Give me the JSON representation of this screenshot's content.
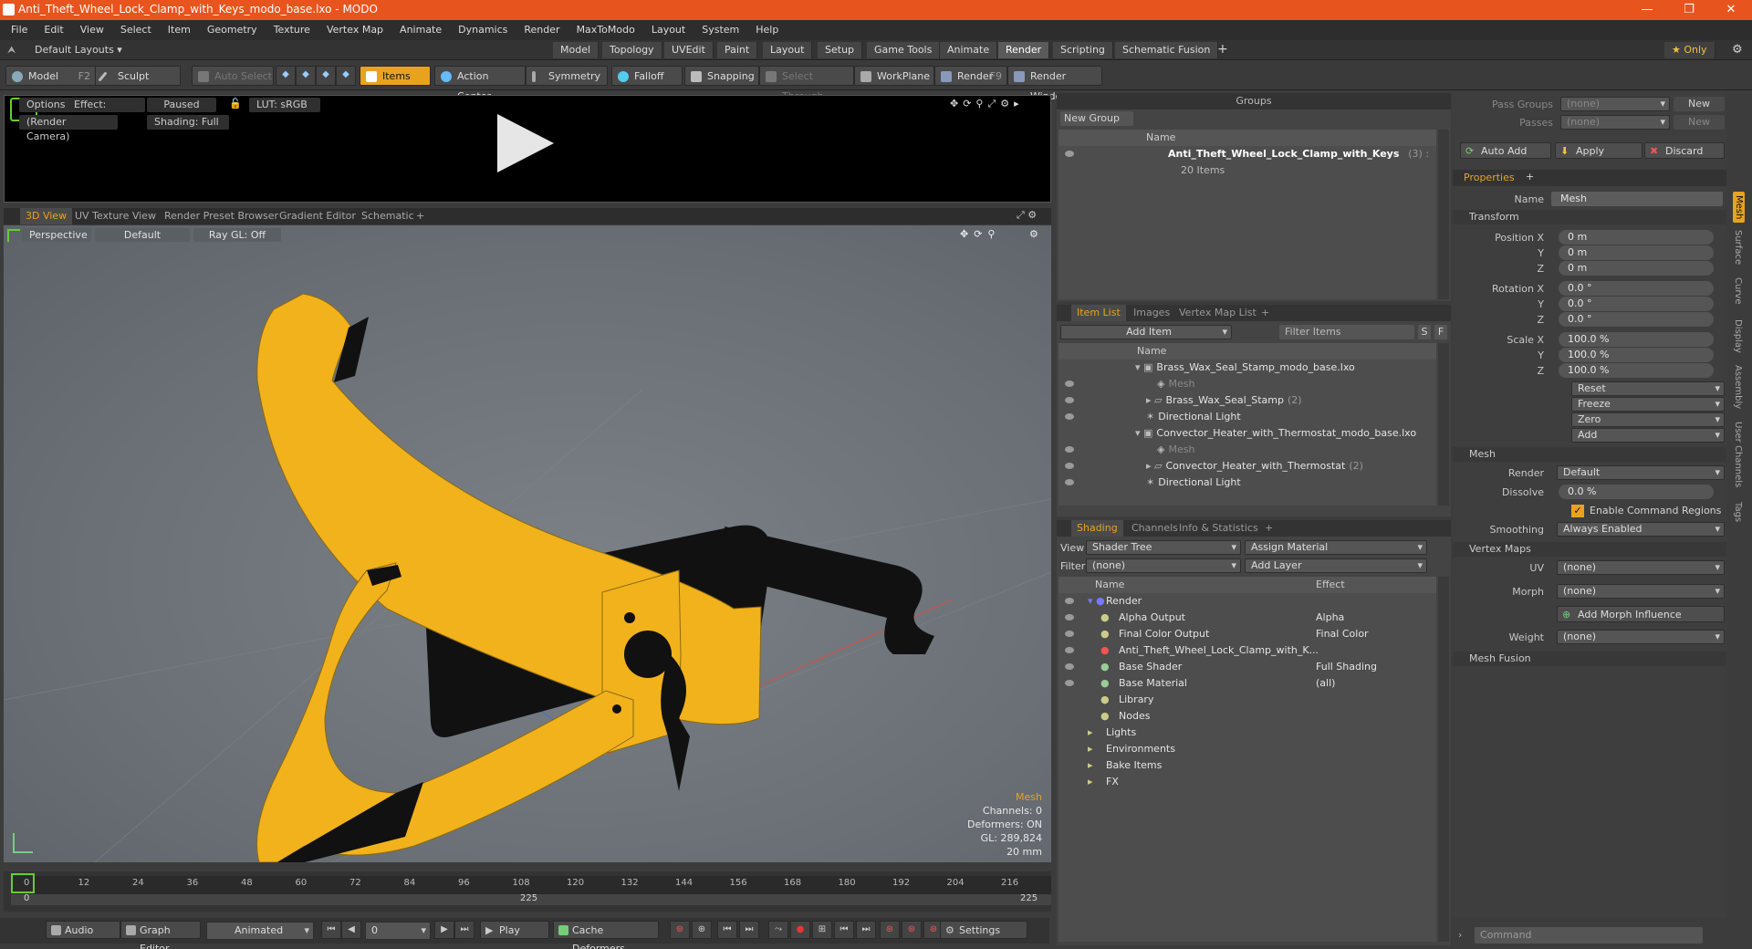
{
  "window": {
    "title": "Anti_Theft_Wheel_Lock_Clamp_with_Keys_modo_base.lxo - MODO",
    "min": "—",
    "max": "❐",
    "close": "✕"
  },
  "menu": [
    "File",
    "Edit",
    "View",
    "Select",
    "Item",
    "Geometry",
    "Texture",
    "Vertex Map",
    "Animate",
    "Dynamics",
    "Render",
    "MaxToModo",
    "Layout",
    "System",
    "Help"
  ],
  "layoutbar": {
    "default_layouts": "Default Layouts ▾",
    "tabs": [
      "Model",
      "Topology",
      "UVEdit",
      "Paint",
      "Layout",
      "Setup",
      "Game Tools",
      "Animate",
      "Render",
      "Scripting",
      "Schematic Fusion"
    ],
    "active_tab": "Render",
    "plus": "+",
    "only": "★  Only"
  },
  "toolbar": {
    "model": "Model",
    "model_key": "F2",
    "sculpt": "Sculpt",
    "auto_select": "Auto Select",
    "items": "Items",
    "action_center": "Action Center",
    "symmetry": "Symmetry",
    "falloff": "Falloff",
    "snapping": "Snapping",
    "select_through": "Select Through",
    "workplane": "WorkPlane",
    "render": "Render",
    "render_key": "F9",
    "render_window": "Render Window"
  },
  "preview": {
    "options": "Options",
    "effect": "Effect: (Shadi...",
    "paused": "Paused",
    "lut": "LUT: sRGB",
    "camera": "(Render Camera)",
    "shading": "Shading: Full"
  },
  "viewport_tabs": [
    "3D View",
    "UV Texture View",
    "Render Preset Browser",
    "Gradient Editor",
    "Schematic",
    "+"
  ],
  "viewport": {
    "perspective": "Perspective",
    "default": "Default",
    "raygl": "Ray GL: Off",
    "info": {
      "type": "Mesh",
      "channels": "Channels: 0",
      "deformers": "Deformers: ON",
      "gl": "GL: 289,824",
      "scale": "20 mm"
    },
    "colors": {
      "body": "#f2b21c",
      "handle": "#111111",
      "edge": "#8a6a10"
    }
  },
  "timeline": {
    "ticks": [
      "0",
      "12",
      "24",
      "36",
      "48",
      "60",
      "72",
      "84",
      "96",
      "108",
      "120",
      "132",
      "144",
      "156",
      "168",
      "180",
      "192",
      "204",
      "216"
    ],
    "start": "0",
    "mid": "225",
    "end": "225"
  },
  "bottombar": {
    "audio": "Audio",
    "graph_editor": "Graph Editor",
    "animated": "Animated",
    "frame": "0",
    "play": "Play",
    "cache_deformers": "Cache Deformers",
    "settings": "Settings"
  },
  "groups": {
    "title": "Groups",
    "new_group": "New Group",
    "col_name": "Name",
    "item": "Anti_Theft_Wheel_Lock_Clamp_with_Keys",
    "item_count": "(3) :",
    "sub": "20 Items"
  },
  "itemlist": {
    "tabs": [
      "Item List",
      "Images",
      "Vertex Map List",
      "+"
    ],
    "add_item": "Add Item",
    "filter": "Filter Items",
    "s": "S",
    "f": "F",
    "col_name": "Name",
    "rows": [
      {
        "label": "Brass_Wax_Seal_Stamp_modo_base.lxo",
        "indent": 0,
        "dim": false
      },
      {
        "label": "Mesh",
        "indent": 2,
        "dim": true
      },
      {
        "label": "Brass_Wax_Seal_Stamp",
        "count": "(2)",
        "indent": 1,
        "dim": false
      },
      {
        "label": "Directional Light",
        "indent": 1,
        "dim": false
      },
      {
        "label": "Convector_Heater_with_Thermostat_modo_base.lxo",
        "indent": 0,
        "dim": false
      },
      {
        "label": "Mesh",
        "indent": 2,
        "dim": true
      },
      {
        "label": "Convector_Heater_with_Thermostat",
        "count": "(2)",
        "indent": 1,
        "dim": false
      },
      {
        "label": "Directional Light",
        "indent": 1,
        "dim": false
      }
    ]
  },
  "shading": {
    "tabs": [
      "Shading",
      "Channels",
      "Info & Statistics",
      "+"
    ],
    "view_label": "View",
    "view": "Shader Tree",
    "assign": "Assign Material",
    "filter_label": "Filter",
    "filter": "(none)",
    "add_layer": "Add Layer",
    "col_name": "Name",
    "col_effect": "Effect",
    "rows": [
      {
        "label": "Render",
        "effect": "",
        "indent": 0
      },
      {
        "label": "Alpha Output",
        "effect": "Alpha",
        "indent": 1
      },
      {
        "label": "Final Color Output",
        "effect": "Final Color",
        "indent": 1
      },
      {
        "label": "Anti_Theft_Wheel_Lock_Clamp_with_K...",
        "effect": "",
        "indent": 1
      },
      {
        "label": "Base Shader",
        "effect": "Full Shading",
        "indent": 1
      },
      {
        "label": "Base Material",
        "effect": "(all)",
        "indent": 1
      },
      {
        "label": "Library",
        "effect": "",
        "indent": 1
      },
      {
        "label": "Nodes",
        "effect": "",
        "indent": 1
      },
      {
        "label": "Lights",
        "effect": "",
        "indent": 0
      },
      {
        "label": "Environments",
        "effect": "",
        "indent": 0
      },
      {
        "label": "Bake Items",
        "effect": "",
        "indent": 0
      },
      {
        "label": "FX",
        "effect": "",
        "indent": 0
      }
    ]
  },
  "props": {
    "pass_groups_label": "Pass Groups",
    "pass_groups": "(none)",
    "new": "New",
    "passes_label": "Passes",
    "passes": "(none)",
    "new2": "New",
    "auto_add": "Auto Add",
    "apply": "Apply",
    "discard": "Discard",
    "tab": "Properties",
    "plus": "+",
    "name_label": "Name",
    "name": "Mesh",
    "transform": "Transform",
    "position_label": "Position X",
    "y": "Y",
    "z": "Z",
    "pos": [
      "0 m",
      "0 m",
      "0 m"
    ],
    "rotation_label": "Rotation X",
    "rot": [
      "0.0 °",
      "0.0 °",
      "0.0 °"
    ],
    "scale_label": "Scale X",
    "scale": [
      "100.0 %",
      "100.0 %",
      "100.0 %"
    ],
    "reset": "Reset",
    "freeze": "Freeze",
    "zero": "Zero",
    "add": "Add",
    "mesh": "Mesh",
    "render_label": "Render",
    "render": "Default",
    "dissolve_label": "Dissolve",
    "dissolve": "0.0 %",
    "enable_cmd": "Enable Command Regions",
    "smoothing_label": "Smoothing",
    "smoothing": "Always Enabled",
    "vertex_maps": "Vertex Maps",
    "uv_label": "UV",
    "uv": "(none)",
    "morph_label": "Morph",
    "morph": "(none)",
    "add_morph": "Add Morph Influence",
    "weight_label": "Weight",
    "weight": "(none)",
    "mesh_fusion": "Mesh Fusion",
    "command_placeholder": "Command"
  },
  "sidetabs": [
    "Mesh",
    "Surface",
    "Curve",
    "Display",
    "Assembly",
    "User Channels",
    "Tags"
  ]
}
